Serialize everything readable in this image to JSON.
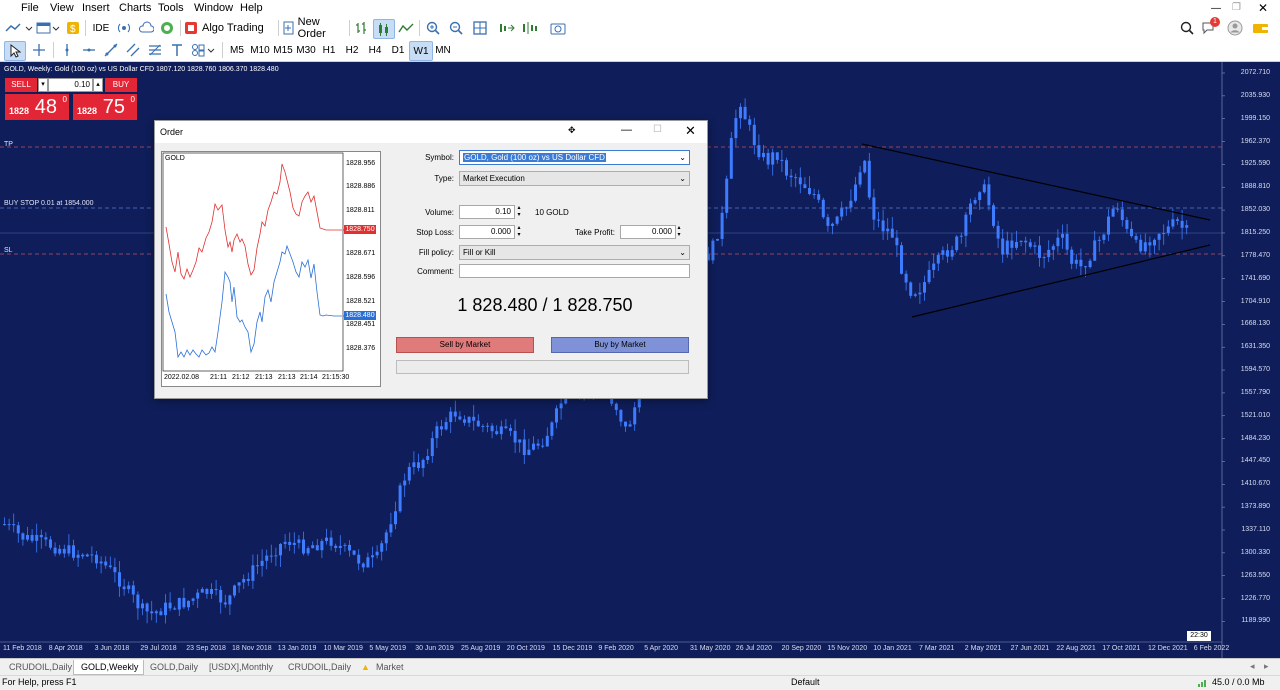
{
  "menu": [
    "File",
    "View",
    "Insert",
    "Charts",
    "Tools",
    "Window",
    "Help"
  ],
  "toolbar": {
    "ide_label": "IDE",
    "algo_trading_label": "Algo Trading",
    "new_order_label": "New Order",
    "notification_count": "1"
  },
  "timeframes": [
    "M5",
    "M10",
    "M15",
    "M30",
    "H1",
    "H2",
    "H4",
    "D1",
    "W1",
    "MN"
  ],
  "active_timeframe": "W1",
  "chart": {
    "title": "GOLD, Weekly:  Gold (100 oz) vs US Dollar CFD  1807.120 1828.760 1806.370 1828.480",
    "tp_label": "TP",
    "buy_stop_label": "BUY STOP 0.01 at 1854.000",
    "sl_label": "SL",
    "time_marker": "22:30",
    "background_color": "#0f1e5a",
    "candle_color": "#3d7bff",
    "price_labels": [
      "2072.710",
      "2035.930",
      "1999.150",
      "1962.370",
      "1925.590",
      "1888.810",
      "1852.030",
      "1815.250",
      "1778.470",
      "1741.690",
      "1704.910",
      "1668.130",
      "1631.350",
      "1594.570",
      "1557.790",
      "1521.010",
      "1484.230",
      "1447.450",
      "1410.670",
      "1373.890",
      "1337.110",
      "1300.330",
      "1263.550",
      "1226.770",
      "1189.990"
    ],
    "date_labels": [
      "11 Feb 2018",
      "8 Apr 2018",
      "3 Jun 2018",
      "29 Jul 2018",
      "23 Sep 2018",
      "18 Nov 2018",
      "13 Jan 2019",
      "10 Mar 2019",
      "5 May 2019",
      "30 Jun 2019",
      "25 Aug 2019",
      "20 Oct 2019",
      "15 Dec 2019",
      "9 Feb 2020",
      "5 Apr 2020",
      "31 May 2020",
      "26 Jul 2020",
      "20 Sep 2020",
      "15 Nov 2020",
      "10 Jan 2021",
      "7 Mar 2021",
      "2 May 2021",
      "27 Jun 2021",
      "22 Aug 2021",
      "17 Oct 2021",
      "12 Dec 2021",
      "6 Feb 2022"
    ]
  },
  "one_click": {
    "volume": "0.10",
    "sell_label": "SELL",
    "buy_label": "BUY",
    "sell_small": "1828",
    "sell_big": "48",
    "sell_sup": "0",
    "buy_small": "1828",
    "buy_big": "75",
    "buy_sup": "0"
  },
  "order_dialog": {
    "title": "Order",
    "symbol_label": "Symbol:",
    "symbol_value": "GOLD, Gold (100 oz) vs US Dollar CFD",
    "type_label": "Type:",
    "type_value": "Market Execution",
    "volume_label": "Volume:",
    "volume_value": "0.10",
    "volume_unit": "10 GOLD",
    "stop_loss_label": "Stop Loss:",
    "stop_loss_value": "0.000",
    "take_profit_label": "Take Profit:",
    "take_profit_value": "0.000",
    "fill_policy_label": "Fill policy:",
    "fill_policy_value": "Fill or Kill",
    "comment_label": "Comment:",
    "comment_value": "",
    "quote": "1 828.480 / 1 828.750",
    "sell_button": "Sell by Market",
    "buy_button": "Buy by Market",
    "mini_chart": {
      "symbol": "GOLD",
      "prices": [
        "1828.956",
        "1828.886",
        "1828.811",
        "1828.750",
        "1828.671",
        "1828.596",
        "1828.521",
        "1828.480",
        "1828.451",
        "1828.376"
      ],
      "ask_tag": "1828.750",
      "bid_tag": "1828.480",
      "times": [
        "2022.02.08",
        "21:11",
        "21:12",
        "21:13",
        "21:13",
        "21:14",
        "21:15:30"
      ]
    }
  },
  "tabs": [
    "CRUDOIL,Daily",
    "GOLD,Weekly",
    "GOLD,Daily",
    "[USDX],Monthly",
    "CRUDOIL,Daily",
    "Market"
  ],
  "active_tab": "GOLD,Weekly",
  "status": {
    "help": "For Help, press F1",
    "profile": "Default",
    "traffic": "45.0 / 0.0 Mb"
  }
}
